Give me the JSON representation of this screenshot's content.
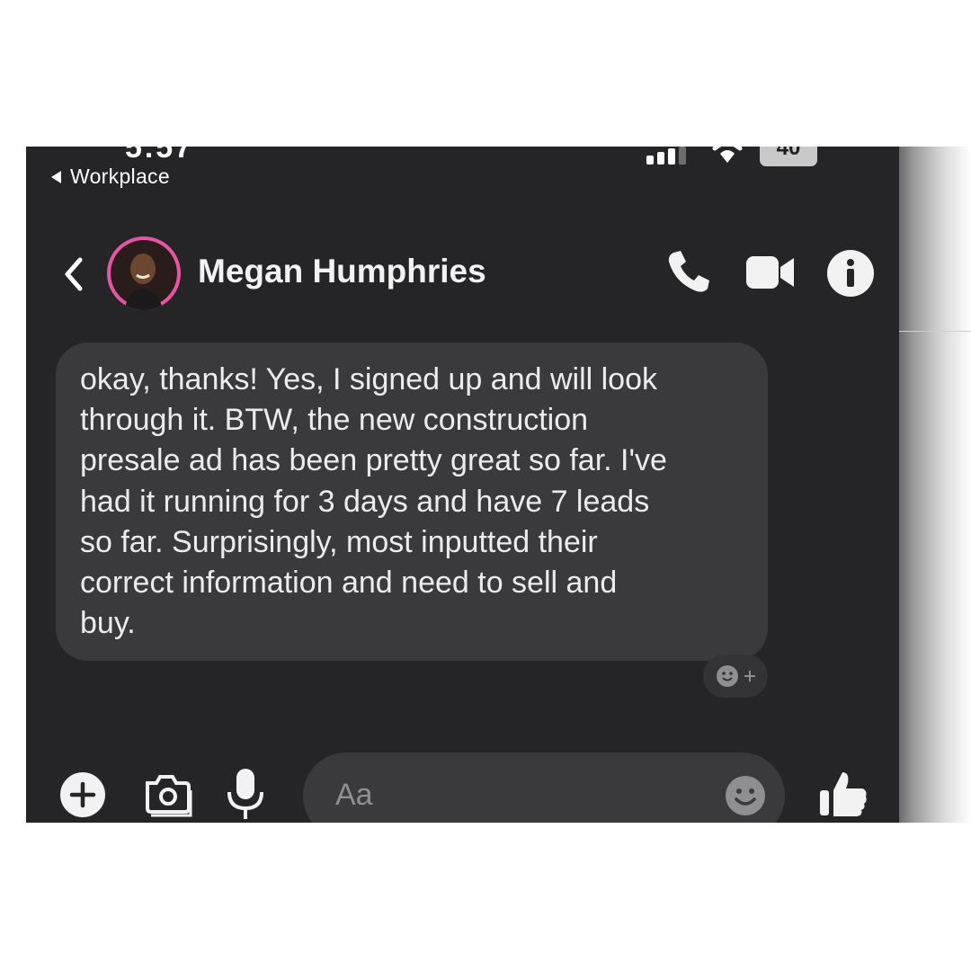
{
  "status_bar": {
    "time_clipped": "5:57",
    "battery": "40"
  },
  "back_app": {
    "label": "Workplace"
  },
  "header": {
    "contact_name": "Megan Humphries",
    "icons": [
      "back-chevron-icon",
      "phone-icon",
      "video-camera-icon",
      "info-icon"
    ]
  },
  "message": {
    "text": "okay, thanks! Yes, I signed up and will look\nthrough it. BTW, the new construction\npresale ad has been pretty great so far. I've\nhad it running for 3 days and have 7 leads\nso far. Surprisingly, most inputted their\ncorrect information and need to sell and\nbuy.",
    "reaction_icon": "add-reaction-icon"
  },
  "composer": {
    "placeholder": "Aa",
    "icons": [
      "plus-icon",
      "camera-icon",
      "microphone-icon",
      "emoji-icon",
      "thumbs-up-icon"
    ]
  },
  "colors": {
    "background": "#252527",
    "bubble": "#3a3a3c",
    "text": "#ececec",
    "avatar_ring": "#e0489e"
  }
}
